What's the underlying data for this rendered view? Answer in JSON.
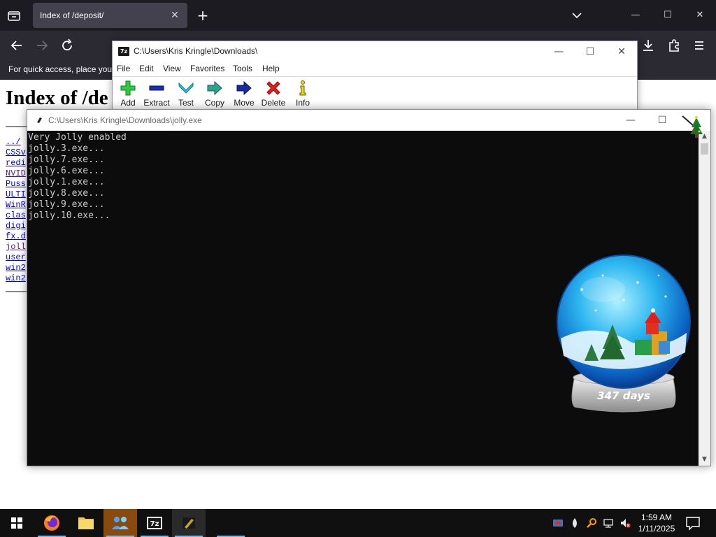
{
  "browser": {
    "tab_title": "Index of /deposit/",
    "tab_close": "✕",
    "new_tab": "+",
    "bookmarks_hint": "For quick access, place your"
  },
  "page": {
    "heading": "Index of /de",
    "links": [
      {
        "text": "../",
        "visited": false
      },
      {
        "text": "CSSv",
        "visited": false
      },
      {
        "text": "redi",
        "visited": false
      },
      {
        "text": "NVID",
        "visited": true
      },
      {
        "text": "Puss",
        "visited": false
      },
      {
        "text": "ULTI",
        "visited": false
      },
      {
        "text": "WinR",
        "visited": false
      },
      {
        "text": "clas",
        "visited": false
      },
      {
        "text": "digi",
        "visited": false
      },
      {
        "text": "fx.d",
        "visited": false
      },
      {
        "text": "joll",
        "visited": true
      },
      {
        "text": "user",
        "visited": false
      },
      {
        "text": "win2",
        "visited": false
      },
      {
        "text": "win2",
        "visited": false
      }
    ]
  },
  "sevenzip": {
    "app_icon": "7z",
    "title": "C:\\Users\\Kris Kringle\\Downloads\\",
    "menu": [
      "File",
      "Edit",
      "View",
      "Favorites",
      "Tools",
      "Help"
    ],
    "toolbar": {
      "add": "Add",
      "extract": "Extract",
      "test": "Test",
      "copy": "Copy",
      "move": "Move",
      "delete": "Delete",
      "info": "Info"
    }
  },
  "console": {
    "title": "C:\\Users\\Kris Kringle\\Downloads\\jolly.exe",
    "lines": [
      "Very Jolly enabled",
      "jolly.3.exe...",
      "jolly.7.exe...",
      "jolly.6.exe...",
      "jolly.1.exe...",
      "jolly.8.exe...",
      "jolly.9.exe...",
      "jolly.10.exe..."
    ]
  },
  "globe": {
    "label": "347 days"
  },
  "window_controls": {
    "minimize": "—",
    "maximize": "☐",
    "close": "✕"
  },
  "taskbar": {
    "time": "1:59 AM",
    "date": "1/11/2025",
    "sevenzip_label": "7z"
  },
  "colors": {
    "browser_dark": "#1c1b22",
    "browser_toolbar": "#2b2a33",
    "link": "#0000ee",
    "link_visited": "#551a8b",
    "console_bg": "#0c0c0c",
    "console_text": "#cccccc",
    "taskbar": "#101010",
    "taskbar_indicator": "#76b9ed"
  }
}
